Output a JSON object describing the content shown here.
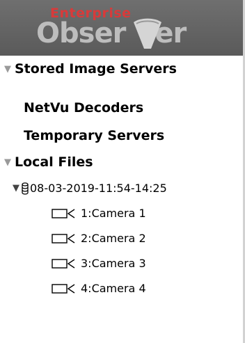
{
  "header": {
    "logo_sub": "Enterprise",
    "logo_main_left": "Obser",
    "logo_main_right": "er"
  },
  "colors": {
    "banner": "#626262",
    "logo_red": "#d93a3a",
    "logo_grey": "#bdbdbd"
  },
  "tree": {
    "stored_image_servers": "Stored Image Servers",
    "netvu_decoders": "NetVu Decoders",
    "temporary_servers": "Temporary Servers",
    "local_files": "Local Files",
    "recording": "08-03-2019-11:54-14:25",
    "cameras": [
      "1:Camera 1",
      "2:Camera 2",
      "3:Camera 3",
      "4:Camera 4"
    ]
  },
  "icons": {
    "expand": "caret-down-icon",
    "database": "database-icon",
    "camera": "camera-icon"
  }
}
